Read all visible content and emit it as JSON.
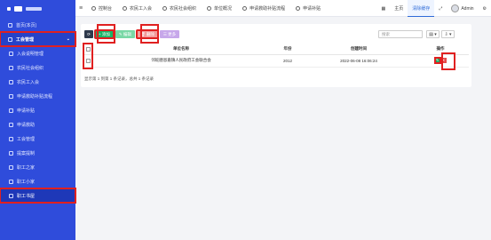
{
  "sidebar": {
    "items": [
      {
        "label": "首页(本页)",
        "icon": "home-icon"
      },
      {
        "label": "工会管理",
        "icon": "org-icon",
        "caret": "⌄"
      },
      {
        "label": "入会说明管理",
        "icon": "doc-icon"
      },
      {
        "label": "农民社会组织",
        "icon": "gear-icon"
      },
      {
        "label": "农民工入会",
        "icon": "gear-icon"
      },
      {
        "label": "申请救助补贴流程",
        "icon": "gear-icon"
      },
      {
        "label": "申请补贴",
        "icon": "list-icon"
      },
      {
        "label": "申请救助",
        "icon": "list-icon"
      },
      {
        "label": "工会管理",
        "icon": "list-icon"
      },
      {
        "label": "提案提制",
        "icon": "list-icon"
      },
      {
        "label": "职工之家",
        "icon": "home-icon"
      },
      {
        "label": "职工小家",
        "icon": "home-icon"
      },
      {
        "label": "职工书屋",
        "icon": "book-icon"
      }
    ]
  },
  "topbar": {
    "menu_icon": "≡",
    "tabs": [
      {
        "label": "控制台",
        "icon": "dashboard-icon"
      },
      {
        "label": "农民工入会",
        "icon": "user-icon"
      },
      {
        "label": "农民社会组织",
        "icon": "gear-icon"
      },
      {
        "label": "单位概况",
        "icon": "gear-icon"
      },
      {
        "label": "申请救助补贴流程",
        "icon": "gear-icon"
      },
      {
        "label": "申请补贴",
        "icon": "list-icon"
      }
    ],
    "right": {
      "grid_icon": "▦",
      "home_label": "主页",
      "cache_label": "清除缓存",
      "expand_icon": "⤢",
      "user_name": "Admin",
      "settings_icon": "⚙"
    }
  },
  "toolbar": {
    "refresh_icon": "⟳",
    "add_label": "+ 添加",
    "edit_label": "✎ 编辑",
    "delete_label": "🗑 删除",
    "more_label": "☰ 更多",
    "search_placeholder": "搜索",
    "view_icon": "▤ ▾",
    "export_icon": "⇩ ▾"
  },
  "table": {
    "headers": [
      "单位名称",
      "年份",
      "创建时间",
      "操作"
    ],
    "rows": [
      {
        "name": "邻蛇膳恩嘉镇人民政府工会联合会",
        "year": "2012",
        "created": "2022-06-08 16:06:24"
      }
    ],
    "edit_icon": "✎",
    "delete_icon": "✕"
  },
  "pager": {
    "text": "显示第 1 到第 1 条记录，总共 1 条记录"
  }
}
